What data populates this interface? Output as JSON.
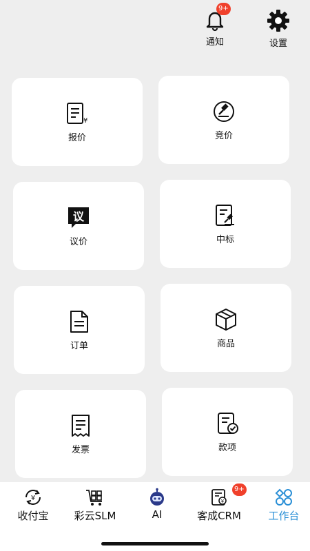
{
  "header": {
    "notify_label": "通知",
    "notify_badge": "9+",
    "settings_label": "设置"
  },
  "cards": {
    "quote": "报价",
    "bid": "竞价",
    "negotiate": "议价",
    "negotiate_icon_text": "议",
    "award": "中标",
    "order": "订单",
    "goods": "商品",
    "invoice": "发票",
    "payment": "款项"
  },
  "nav": {
    "shoufubao": "收付宝",
    "caiyun": "彩云SLM",
    "ai": "AI",
    "crm": "客成CRM",
    "crm_badge": "9+",
    "workbench": "工作台"
  },
  "colors": {
    "accent": "#2a8fd6",
    "badge": "#f0402b",
    "background": "#eeeeee"
  }
}
